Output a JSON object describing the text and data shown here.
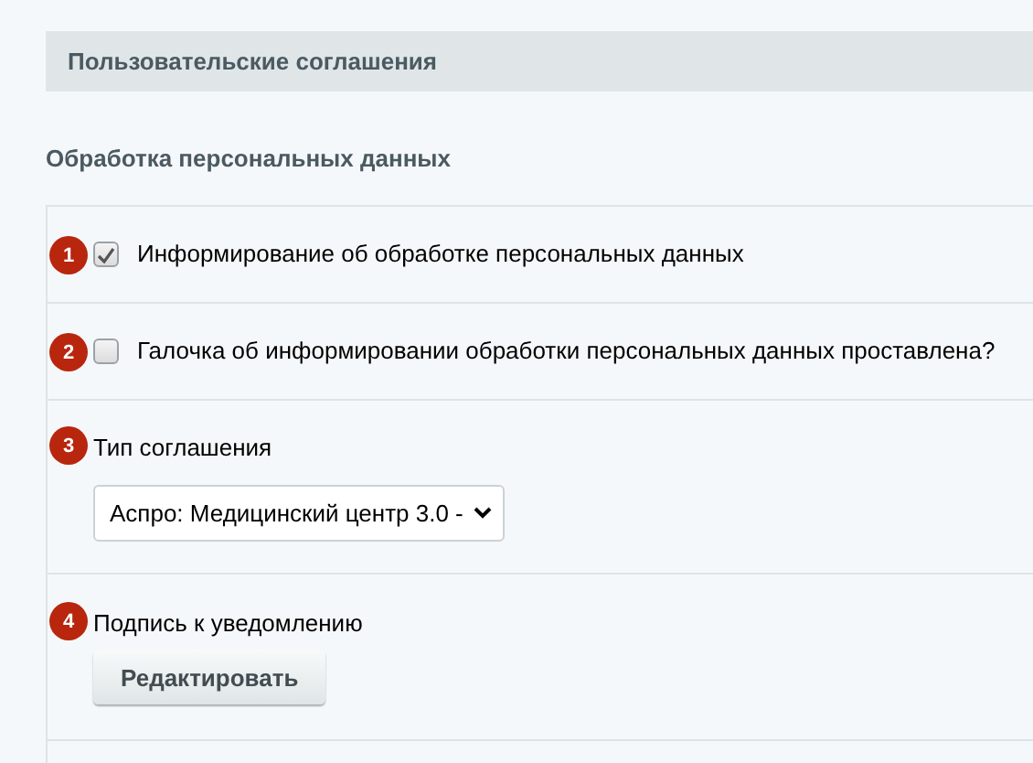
{
  "header": {
    "title": "Пользовательские соглашения"
  },
  "section": {
    "title": "Обработка персональных данных"
  },
  "rows": [
    {
      "kind": "checkbox",
      "badge": "1",
      "label": "Информирование об обработке персональных данных",
      "checked": true
    },
    {
      "kind": "checkbox",
      "badge": "2",
      "label": "Галочка об информировании обработки персональных данных проставлена?",
      "checked": false
    },
    {
      "kind": "select",
      "badge": "3",
      "label": "Тип соглашения",
      "value": "Аспро: Медицинский центр 3.0 -"
    },
    {
      "kind": "button",
      "badge": "4",
      "label": "Подпись к уведомлению",
      "button": "Редактировать"
    }
  ]
}
